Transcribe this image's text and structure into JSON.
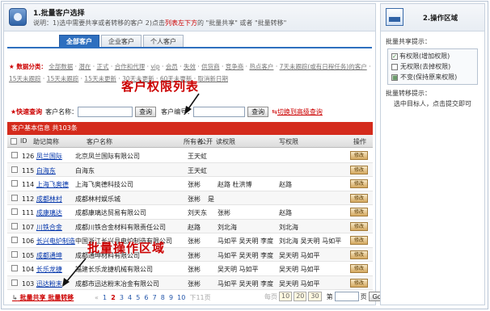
{
  "step1": {
    "title": "1.批量客户选择",
    "desc_prefix": "说明：1)选中需要共享或者转移的客户  2)点击",
    "desc_red": "列表左下方",
    "desc_suffix": "的 \"批量共享\" 或者 \"批量转移\""
  },
  "tabs": [
    {
      "label": "全部客户",
      "active": true
    },
    {
      "label": "企业客户",
      "active": false
    },
    {
      "label": "个人客户",
      "active": false
    }
  ],
  "filters": {
    "title": "数据分类",
    "options": [
      "全部数据",
      "潜在",
      "正式",
      "合作和代理",
      "vip",
      "会员",
      "失效",
      "供货商",
      "竞争商",
      "热点客户",
      "7天未跟踪(或有日程任务)的客户",
      "15天未跟踪",
      "15天未跟踪",
      "15天未更新",
      "30天未更新",
      "60天未更新",
      "取消新日期"
    ]
  },
  "quick_search": {
    "title": "快速查询",
    "name_label": "客户名称：",
    "button_label": "查询",
    "code_label": "客户编号：",
    "button2_label": "查询",
    "link_label": "切换到高级查询"
  },
  "grid": {
    "title": "客户基本信息 共103条",
    "columns": [
      "ID",
      "助记简称",
      "客户名称",
      "所有者",
      "公开",
      "读权限",
      "写权限",
      "操作"
    ],
    "op_label": "修改",
    "rows": [
      {
        "id": "126",
        "abbr": "凤兰国际",
        "name": "北京凤兰国际有限公司",
        "owner": "王天虹",
        "read": "",
        "write": ""
      },
      {
        "id": "115",
        "abbr": "白海东",
        "name": "白海东",
        "owner": "王天虹",
        "read": "",
        "write": ""
      },
      {
        "id": "114",
        "abbr": "上海飞奥德",
        "name": "上海飞奥德科技公司",
        "owner": "张彬",
        "read": "赵路 杜洪博",
        "write": "赵路"
      },
      {
        "id": "112",
        "abbr": "成都林村",
        "name": "成都林村娱乐城",
        "owner": "张彬",
        "read": "是",
        "write": ""
      },
      {
        "id": "111",
        "abbr": "成康璃达",
        "name": "成都康璃达贸易有限公司",
        "owner": "刘天东",
        "read": "张彬",
        "write": "赵路"
      },
      {
        "id": "107",
        "abbr": "川铁合金",
        "name": "成都川铁合金材料有限责任公司",
        "owner": "赵路",
        "read": "刘北海",
        "write": "刘北海"
      },
      {
        "id": "106",
        "abbr": "长兴电炉制造",
        "name": "中国浙江长兴县电炉制造有限公司",
        "owner": "张彬",
        "read": "马如平 吴天明 李度",
        "write": "刘北海 吴天明 马如平"
      },
      {
        "id": "105",
        "abbr": "成都通坤",
        "name": "成都通坤材料有限公司",
        "owner": "张彬",
        "read": "马如平 吴天明 李度",
        "write": "吴天明 马如平"
      },
      {
        "id": "104",
        "abbr": "长乐龙捷",
        "name": "福建长乐龙捷机械有限公司",
        "owner": "张彬",
        "read": "吴天明 马如平",
        "write": "吴天明 马如平"
      },
      {
        "id": "103",
        "abbr": "迅达粉末",
        "name": "成都市迅达粉末冶金有限公司",
        "owner": "张彬",
        "read": "马如平 吴天明 李度",
        "write": "吴天明 马如平"
      }
    ]
  },
  "footer": {
    "batch_share": "批量共享",
    "batch_move": "批量转移",
    "pages": [
      "1",
      "2",
      "3",
      "4",
      "5",
      "6",
      "7",
      "8",
      "9",
      "10",
      "下11页"
    ],
    "current_page": "2",
    "prev": "«",
    "per_page_label": "每页",
    "per_page": [
      "10",
      "20",
      "30"
    ],
    "goto_label": "第",
    "goto_unit": "页",
    "go_button": "Go"
  },
  "annotations": {
    "perm_list": "客户权限列表",
    "batch_area": "批量操作区域"
  },
  "side": {
    "title": "2.操作区域",
    "share_hint": "批量共享提示：",
    "items": [
      {
        "glyph": "✓",
        "label": "有权限(增加权限)"
      },
      {
        "glyph": "",
        "label": "无权限(去掉权限)"
      },
      {
        "glyph": "■",
        "label": "不变(保持原来权限)"
      }
    ],
    "move_hint": "批量转移提示：",
    "move_desc": "选中目标人，点击提交即可"
  },
  "colors": {
    "accent": "#2e6fbf",
    "header_red": "#d42b1c",
    "annotation": "#cc0000"
  }
}
